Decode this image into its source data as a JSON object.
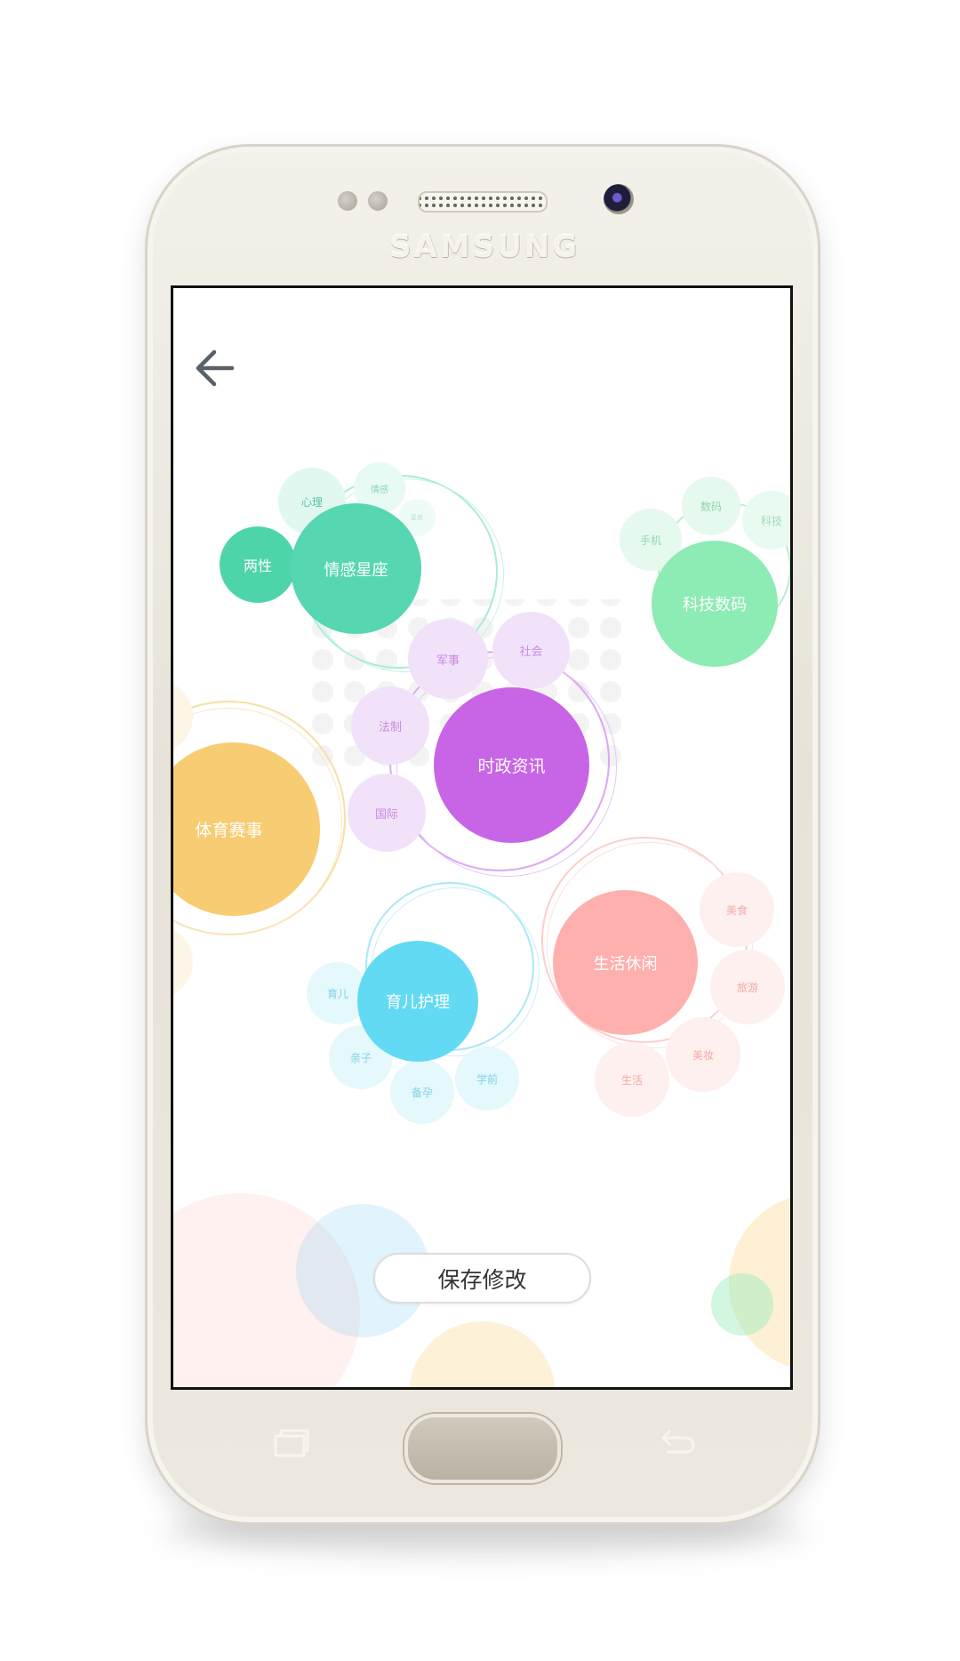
{
  "device": {
    "brand": "SAMSUNG"
  },
  "header": {
    "back_icon": "arrow-left-icon"
  },
  "groups": {
    "emotion": {
      "main": "情感星座",
      "sub": [
        "两性",
        "心理",
        "情感",
        "星座"
      ],
      "color": "#56d6b1"
    },
    "tech": {
      "main": "科技数码",
      "sub": [
        "数码",
        "手机",
        "科技"
      ],
      "color": "#8debb4"
    },
    "politics": {
      "main": "时政资讯",
      "sub": [
        "军事",
        "社会",
        "法制",
        "国际"
      ],
      "color": "#c865e6"
    },
    "sports": {
      "main": "体育赛事",
      "color": "#f8cc72"
    },
    "parenting": {
      "main": "育儿护理",
      "sub": [
        "育儿",
        "亲子",
        "备孕",
        "学前"
      ],
      "color": "#63daf3"
    },
    "life": {
      "main": "生活休闲",
      "sub": [
        "美食",
        "旅游",
        "美妆",
        "生活"
      ],
      "color": "#fdb0ae"
    }
  },
  "actions": {
    "save_label": "保存修改"
  }
}
